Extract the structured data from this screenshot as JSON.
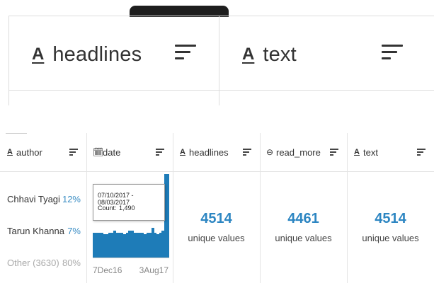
{
  "zoom": {
    "columns": [
      {
        "type_icon": "A",
        "label": "headlines"
      },
      {
        "type_icon": "A",
        "label": "text"
      }
    ]
  },
  "table": {
    "columns": [
      {
        "key": "author",
        "type_icon": "A",
        "label": "author"
      },
      {
        "key": "date",
        "type_icon": "🗓",
        "label": "date"
      },
      {
        "key": "headlines",
        "type_icon": "A",
        "label": "headlines"
      },
      {
        "key": "read_more",
        "type_icon": "⊖",
        "label": "read_more"
      },
      {
        "key": "text",
        "type_icon": "A",
        "label": "text"
      }
    ],
    "author": {
      "rows": [
        {
          "name": "Chhavi Tyagi",
          "pct": "12%"
        },
        {
          "name": "Tarun Khanna",
          "pct": "7%"
        },
        {
          "name": "Other (3630)",
          "pct": "80%"
        }
      ]
    },
    "date": {
      "tooltip": {
        "range": "07/10/2017 - 08/03/2017",
        "count_label": "Count:",
        "count_value": "1,490"
      },
      "axis_start": "7Dec16",
      "axis_end": "3Aug17",
      "histogram": [
        0.3,
        0.3,
        0.3,
        0.3,
        0.28,
        0.28,
        0.3,
        0.3,
        0.32,
        0.3,
        0.3,
        0.3,
        0.28,
        0.3,
        0.32,
        0.32,
        0.3,
        0.3,
        0.3,
        0.3,
        0.28,
        0.3,
        0.3,
        0.36,
        0.3,
        0.28,
        0.3,
        0.32,
        1.0,
        1.0
      ]
    },
    "headlines": {
      "unique": "4514",
      "unique_label": "unique values"
    },
    "read_more": {
      "unique": "4461",
      "unique_label": "unique values"
    },
    "text": {
      "unique": "4514",
      "unique_label": "unique values"
    }
  },
  "colors": {
    "accent": "#2d86c2",
    "bar": "#1e7cb8"
  }
}
